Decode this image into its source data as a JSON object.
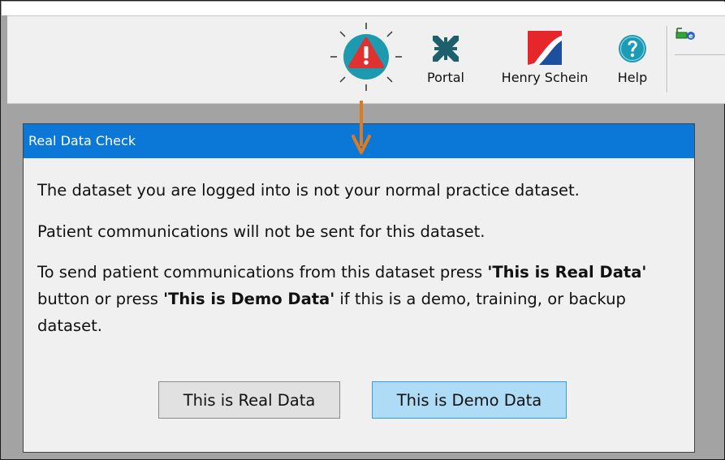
{
  "toolbar": {
    "buttons": [
      {
        "label": "Portal",
        "icon": "portal-arrows-icon"
      },
      {
        "label": "Henry Schein",
        "icon": "henry-schein-logo-icon"
      },
      {
        "label": "Help",
        "icon": "help-icon"
      }
    ]
  },
  "dialog": {
    "title": "Real Data Check",
    "line1": "The dataset you are logged into is not your normal practice dataset.",
    "line2": "Patient communications will not be sent for this dataset.",
    "line3_a": "To send patient communications from this dataset press ",
    "line3_b": "'This is Real Data'",
    "line3_c": " button or press ",
    "line3_d": "'This is Demo Data'",
    "line3_e": " if this is a demo, training, or backup dataset.",
    "real_button": "This is Real Data",
    "demo_button": "This is Demo Data"
  },
  "colors": {
    "titlebar": "#0b78d7",
    "demo_button_bg": "#aedcf7",
    "warning_circle": "#1e9ab0",
    "warning_triangle": "#e03131",
    "arrow": "#e07a1e",
    "portal_icon": "#1d5f6a",
    "help_icon": "#1b9bb4",
    "schein_red": "#e5262b",
    "schein_blue": "#1d4f9c"
  }
}
